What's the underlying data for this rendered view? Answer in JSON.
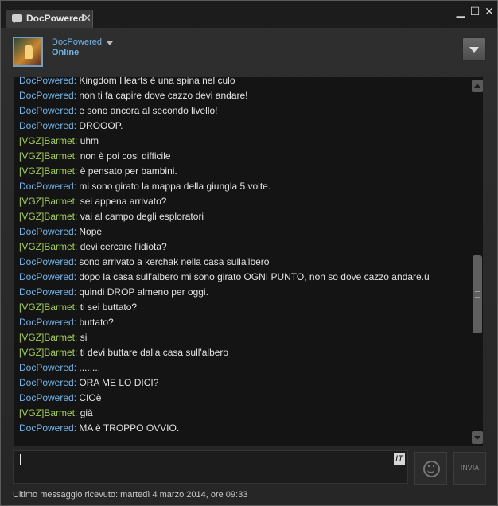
{
  "window": {
    "tab_title": "DocPowered",
    "tab_close": "✕",
    "controls": {
      "minimize": "▁",
      "maximize": "☐",
      "close": "✕"
    }
  },
  "header": {
    "user_name": "DocPowered",
    "status": "Online"
  },
  "messages": [
    {
      "sender": "DocPowered",
      "role": "self",
      "text": "Kingdom Hearts è una spina nel culo"
    },
    {
      "sender": "DocPowered",
      "role": "self",
      "text": "non ti fa capire dove cazzo devi andare!"
    },
    {
      "sender": "DocPowered",
      "role": "self",
      "text": "e sono ancora al secondo livello!"
    },
    {
      "sender": "DocPowered",
      "role": "self",
      "text": "DROOOP."
    },
    {
      "sender": "[VGZ]Barmet",
      "role": "friend",
      "text": "uhm"
    },
    {
      "sender": "[VGZ]Barmet",
      "role": "friend",
      "text": "non è poi cosi difficile"
    },
    {
      "sender": "[VGZ]Barmet",
      "role": "friend",
      "text": "è pensato per bambini."
    },
    {
      "sender": "DocPowered",
      "role": "self",
      "text": "mi sono girato la mappa della giungla 5 volte."
    },
    {
      "sender": "[VGZ]Barmet",
      "role": "friend",
      "text": "sei appena arrivato?"
    },
    {
      "sender": "[VGZ]Barmet",
      "role": "friend",
      "text": "vai al campo degli esploratori"
    },
    {
      "sender": "DocPowered",
      "role": "self",
      "text": "Nope"
    },
    {
      "sender": "[VGZ]Barmet",
      "role": "friend",
      "text": "devi cercare l'idiota?"
    },
    {
      "sender": "DocPowered",
      "role": "self",
      "text": "sono arrivato a kerchak nella casa sulla'lbero"
    },
    {
      "sender": "DocPowered",
      "role": "self",
      "text": "dopo la casa sull'albero mi sono girato OGNI PUNTO, non so dove cazzo andare.ù"
    },
    {
      "sender": "DocPowered",
      "role": "self",
      "text": "quindi DROP almeno per oggi."
    },
    {
      "sender": "[VGZ]Barmet",
      "role": "friend",
      "text": "ti sei buttato?"
    },
    {
      "sender": "DocPowered",
      "role": "self",
      "text": "buttato?"
    },
    {
      "sender": "[VGZ]Barmet",
      "role": "friend",
      "text": "si"
    },
    {
      "sender": "[VGZ]Barmet",
      "role": "friend",
      "text": "ti devi buttare dalla casa sull'albero"
    },
    {
      "sender": "DocPowered",
      "role": "self",
      "text": "........"
    },
    {
      "sender": "DocPowered",
      "role": "self",
      "text": "ORA ME LO DICI?"
    },
    {
      "sender": "DocPowered",
      "role": "self",
      "text": "CIOè"
    },
    {
      "sender": "[VGZ]Barmet",
      "role": "friend",
      "text": "già"
    },
    {
      "sender": "DocPowered",
      "role": "self",
      "text": "MA è TROPPO OVVIO."
    }
  ],
  "input": {
    "value": "",
    "language_badge": "IT"
  },
  "buttons": {
    "send": "INVIA"
  },
  "footer": {
    "last_message": "Ultimo messaggio ricevuto: martedì 4 marzo 2014, ore 09:33"
  },
  "colors": {
    "self_sender": "#6fb6ea",
    "friend_sender": "#a3cf4e",
    "message_text": "#e2e2e2"
  }
}
